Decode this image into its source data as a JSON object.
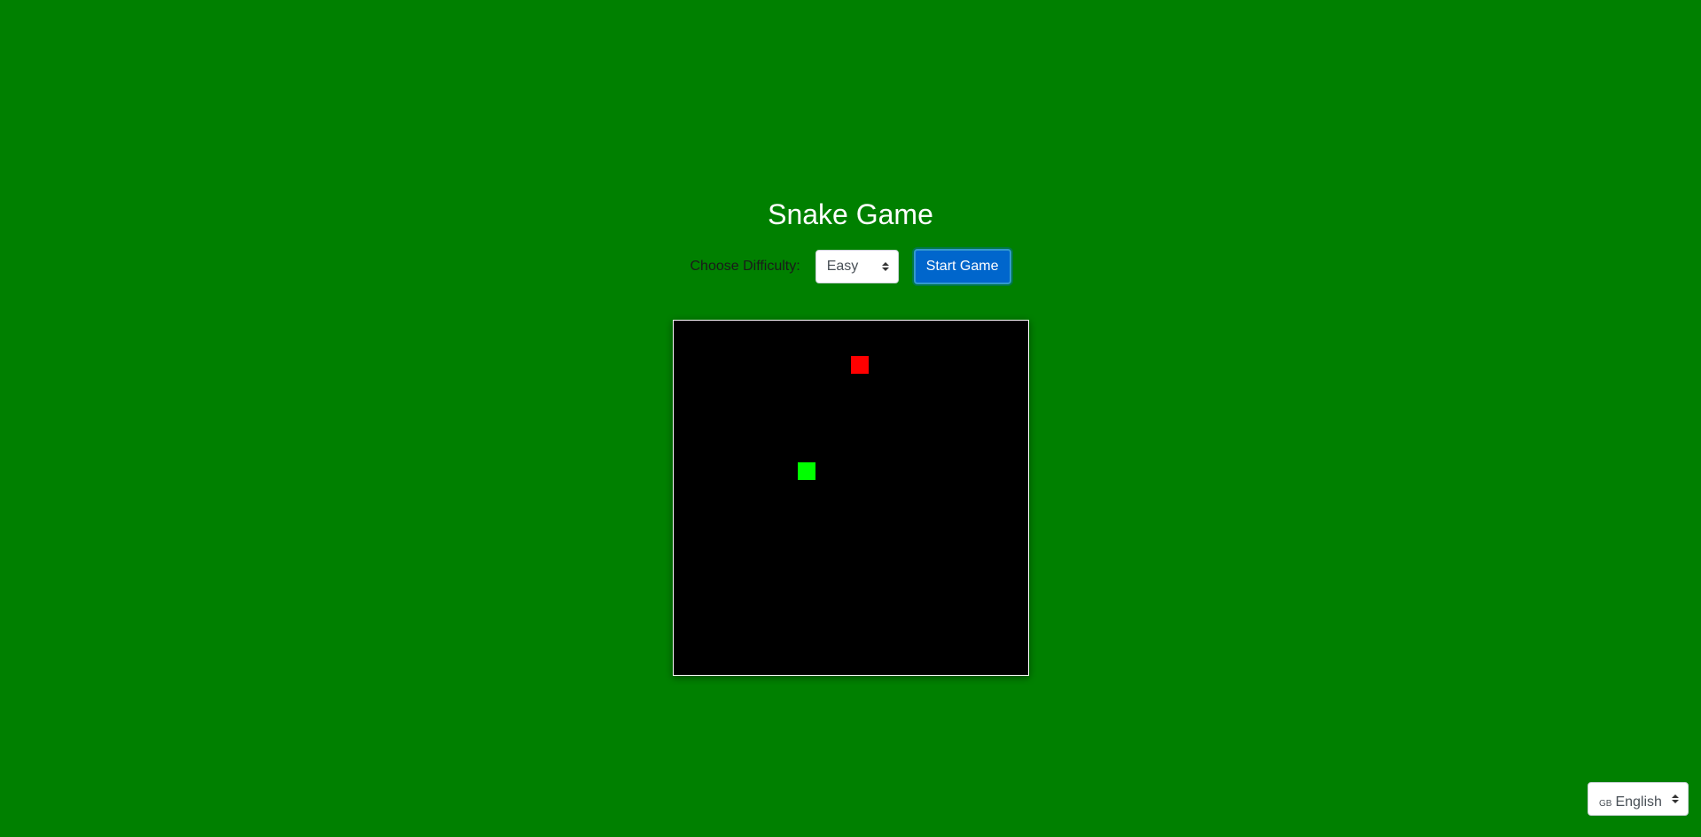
{
  "page": {
    "title": "Snake Game",
    "background_color": "#008000"
  },
  "controls": {
    "difficulty_label": "Choose Difficulty:",
    "difficulty_selected": "Easy",
    "start_button_label": "Start Game",
    "start_button_color": "#0066cc"
  },
  "board": {
    "background_color": "#000000",
    "grid_columns": 20,
    "grid_rows": 20,
    "snake": {
      "color": "#00ff00",
      "segments": [
        {
          "col": 7,
          "row": 8
        }
      ]
    },
    "food": {
      "color": "#ff0000",
      "col": 10,
      "row": 2
    }
  },
  "language": {
    "flag_code": "GB",
    "selected": "English"
  }
}
